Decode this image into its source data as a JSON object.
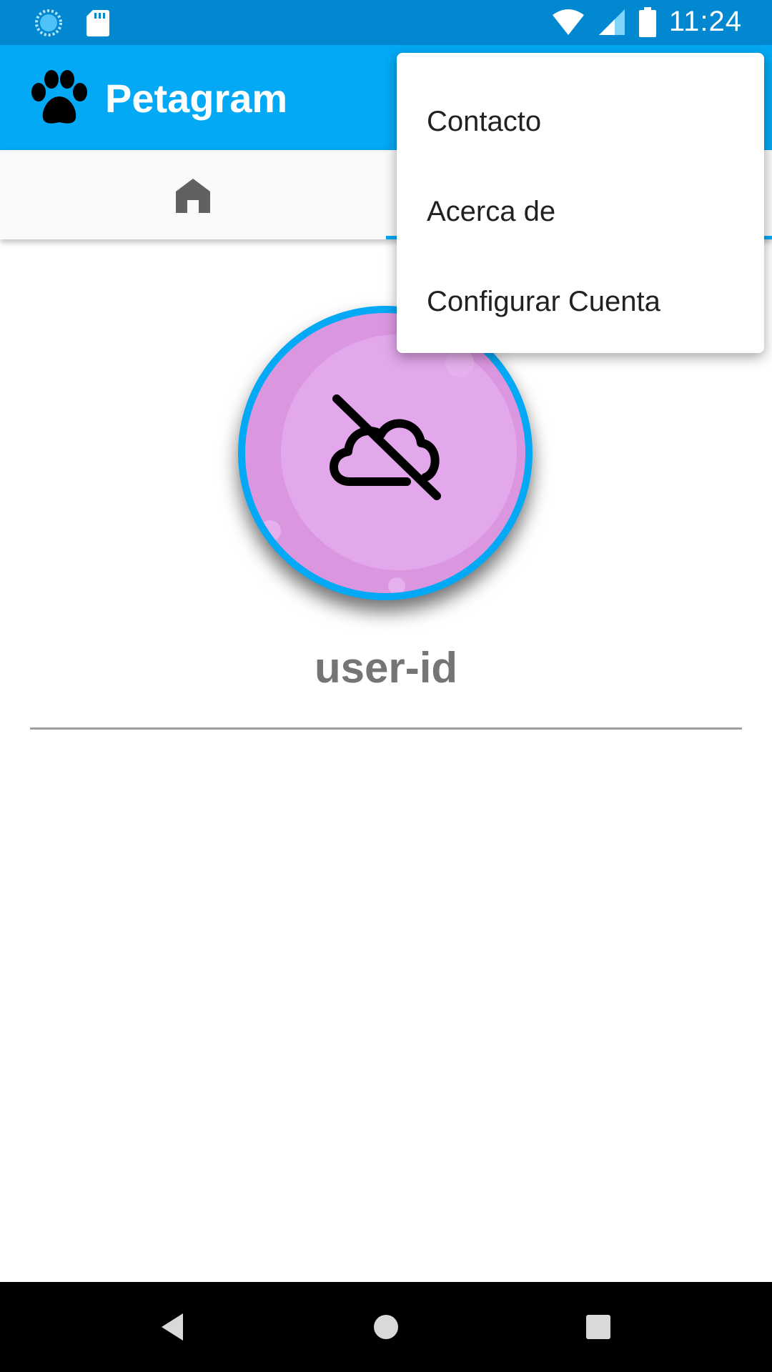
{
  "status_bar": {
    "time": "11:24",
    "icons": [
      "sync-icon",
      "sd-card-icon",
      "wifi-icon",
      "signal-icon",
      "battery-icon"
    ]
  },
  "app_bar": {
    "title": "Petagram",
    "logo_icon": "paw-icon",
    "color": "#03a9f4"
  },
  "tabs": {
    "items": [
      {
        "icon": "home-icon",
        "selected": false
      },
      {
        "icon": "profile-tab",
        "selected": true
      }
    ],
    "indicator_color": "#03a9f4"
  },
  "profile": {
    "avatar_icon": "cloud-off-icon",
    "username": "user-id"
  },
  "overflow_menu": {
    "items": [
      {
        "label": "Contacto"
      },
      {
        "label": "Acerca de"
      },
      {
        "label": "Configurar Cuenta"
      }
    ]
  },
  "nav_bar": {
    "buttons": [
      "back-icon",
      "home-circle-icon",
      "recents-icon"
    ]
  }
}
